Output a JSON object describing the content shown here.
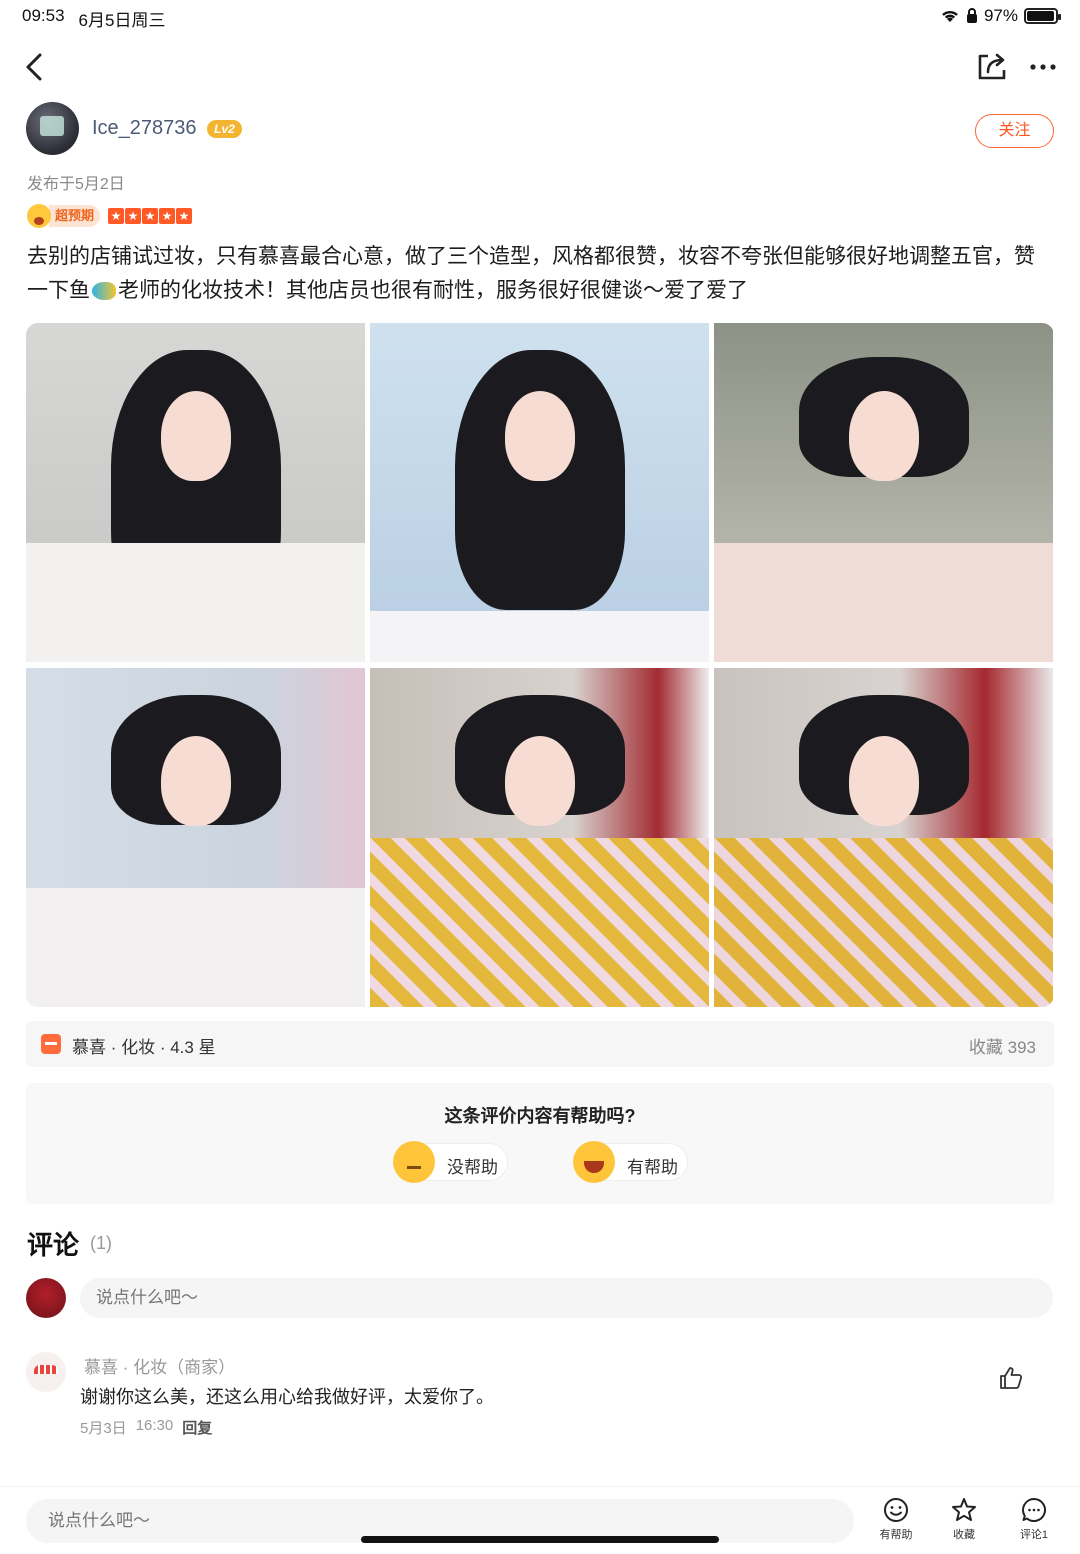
{
  "status": {
    "time": "09:53",
    "date": "6月5日周三",
    "battery": "97%",
    "battery_level": 0.97
  },
  "author": {
    "name": "Ice_278736",
    "level": "Lv2",
    "follow_label": "关注"
  },
  "post": {
    "published": "发布于5月2日",
    "rating_tag": "超预期",
    "stars": 5,
    "text_part1": "去别的店铺试过妆，只有慕喜最合心意，做了三个造型，风格都很赞，妆容不夸张但能够很好地调整五官，赞一下鱼",
    "text_part2": "老师的化妆技术！其他店员也很有耐性，服务很好很健谈～爱了爱了",
    "photo_count": 6
  },
  "shop": {
    "name": "慕喜 · 化妆 · 4.3 星",
    "favorites": "收藏 393"
  },
  "helpful": {
    "question": "这条评价内容有帮助吗?",
    "no_label": "没帮助",
    "yes_label": "有帮助"
  },
  "comments": {
    "title": "评论",
    "count": "(1)",
    "input_placeholder": "说点什么吧～",
    "items": [
      {
        "author": "慕喜 · 化妆（商家）",
        "text": "谢谢你这么美，还这么用心给我做好评，太爱你了。",
        "date": "5月3日",
        "time": "16:30",
        "reply_label": "回复"
      }
    ]
  },
  "bottom_bar": {
    "input_placeholder": "说点什么吧～",
    "helpful_label": "有帮助",
    "favorite_label": "收藏",
    "comment_label": "评论1"
  },
  "icons": {
    "back": "back-arrow-icon",
    "share": "share-icon",
    "more": "more-dots-icon",
    "like": "thumbs-up-icon",
    "smile": "smile-icon",
    "star": "star-icon",
    "comment": "comment-bubble-icon"
  },
  "colors": {
    "accent": "#ff5522",
    "star": "#ff5a26",
    "badge": "#f3b531"
  }
}
